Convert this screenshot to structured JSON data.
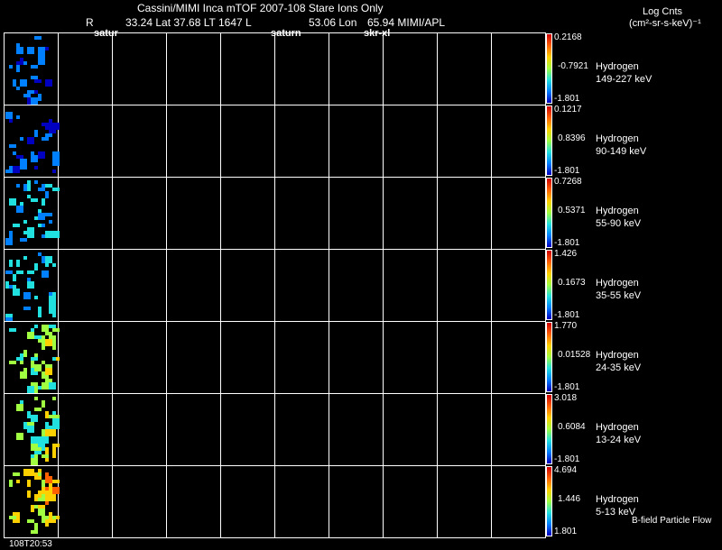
{
  "header": {
    "title": "Cassini/MIMI Inca mTOF  2007-108   Stare   Ions Only",
    "r_label": "R",
    "position_text": "33.24 Lat 37.68 LT 1647 L",
    "lon_text": "53.06 Lon",
    "tail_text": "65.94  MIMI/APL",
    "overlay_1": "satur",
    "overlay_2": "saturn",
    "overlay_3": "skr-xl"
  },
  "units": {
    "line1": "Log Cnts",
    "line2": "(cm²-sr-s-keV)⁻¹"
  },
  "footer": {
    "time": "108T20:53",
    "legend_note": "B-field Particle Flow"
  },
  "chart_data": {
    "type": "heatmap",
    "grid": true,
    "colormap": [
      "#d00000",
      "#ff6000",
      "#ffd000",
      "#a0ff40",
      "#20e0e0",
      "#0080ff",
      "#0000c0"
    ],
    "panels": [
      {
        "species": "Hydrogen",
        "energy": "149-227 keV",
        "cb_max": "0.2168",
        "cb_mid": "-0.7921",
        "cb_min": "-1.801"
      },
      {
        "species": "Hydrogen",
        "energy": "90-149 keV",
        "cb_max": "0.1217",
        "cb_mid": "0.8396",
        "cb_min": "-1.801"
      },
      {
        "species": "Hydrogen",
        "energy": "55-90 keV",
        "cb_max": "0.7268",
        "cb_mid": "0.5371",
        "cb_min": "-1.801"
      },
      {
        "species": "Hydrogen",
        "energy": "35-55 keV",
        "cb_max": "1.426",
        "cb_mid": "0.1673",
        "cb_min": "-1.801"
      },
      {
        "species": "Hydrogen",
        "energy": "24-35 keV",
        "cb_max": "1.770",
        "cb_mid": "0.01528",
        "cb_min": "-1.801"
      },
      {
        "species": "Hydrogen",
        "energy": "13-24 keV",
        "cb_max": "3.018",
        "cb_mid": "0.6084",
        "cb_min": "-1.801"
      },
      {
        "species": "Hydrogen",
        "energy": "5-13 keV",
        "cb_max": "4.694",
        "cb_mid": "1.446",
        "cb_min": "1.801"
      }
    ]
  }
}
